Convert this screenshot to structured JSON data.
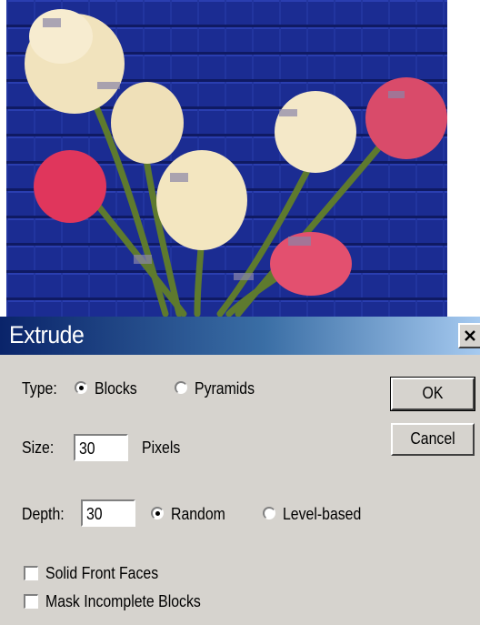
{
  "dialog": {
    "title": "Extrude",
    "type_label": "Type:",
    "type_options": [
      {
        "label": "Blocks",
        "selected": true
      },
      {
        "label": "Pyramids",
        "selected": false
      }
    ],
    "size_label": "Size:",
    "size_value": "30",
    "size_unit": "Pixels",
    "depth_label": "Depth:",
    "depth_value": "30",
    "depth_options": [
      {
        "label": "Random",
        "selected": true
      },
      {
        "label": "Level-based",
        "selected": false
      }
    ],
    "checkboxes": [
      {
        "label": "Solid Front Faces",
        "checked": false
      },
      {
        "label": "Mask Incomplete Blocks",
        "checked": false
      }
    ],
    "ok_label": "OK",
    "cancel_label": "Cancel"
  },
  "colors": {
    "background_blue": "#17278a",
    "dialog_face": "#d6d3ce",
    "title_gradient_start": "#0a246a",
    "title_gradient_end": "#a6caf0"
  },
  "icons": {
    "close": "close-icon"
  }
}
